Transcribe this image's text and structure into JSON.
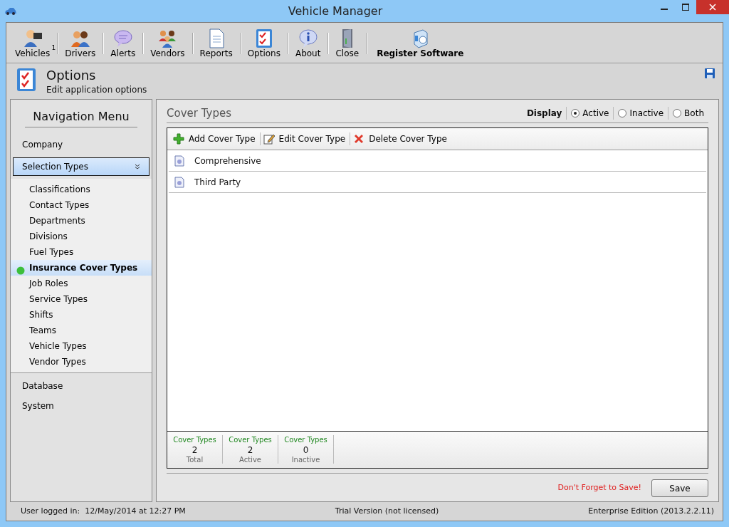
{
  "window": {
    "title": "Vehicle Manager"
  },
  "toolbar": [
    {
      "label": "Vehicles",
      "kind": "tool",
      "badge": "1"
    },
    {
      "label": "Drivers",
      "kind": "tool"
    },
    {
      "label": "Alerts",
      "kind": "tool"
    },
    {
      "label": "Vendors",
      "kind": "tool"
    },
    {
      "label": "Reports",
      "kind": "tool"
    },
    {
      "label": "Options",
      "kind": "tool"
    },
    {
      "label": "About",
      "kind": "tool"
    },
    {
      "label": "Close",
      "kind": "tool"
    },
    {
      "label": "Register Software",
      "kind": "highlight"
    }
  ],
  "header": {
    "title": "Options",
    "subtitle": "Edit application options"
  },
  "sidebar": {
    "title": "Navigation Menu",
    "items": [
      {
        "label": "Company",
        "expanded": false
      },
      {
        "label": "Selection Types",
        "expanded": true,
        "children": [
          {
            "label": "Classifications",
            "selected": false
          },
          {
            "label": "Contact Types",
            "selected": false
          },
          {
            "label": "Departments",
            "selected": false
          },
          {
            "label": "Divisions",
            "selected": false
          },
          {
            "label": "Fuel Types",
            "selected": false
          },
          {
            "label": "Insurance Cover Types",
            "selected": true
          },
          {
            "label": "Job Roles",
            "selected": false
          },
          {
            "label": "Service Types",
            "selected": false
          },
          {
            "label": "Shifts",
            "selected": false
          },
          {
            "label": "Teams",
            "selected": false
          },
          {
            "label": "Vehicle Types",
            "selected": false
          },
          {
            "label": "Vendor Types",
            "selected": false
          }
        ]
      },
      {
        "label": "Database",
        "expanded": false
      },
      {
        "label": "System",
        "expanded": false
      }
    ]
  },
  "content": {
    "title": "Cover Types",
    "display_label": "Display",
    "display_options": [
      {
        "label": "Active",
        "selected": true
      },
      {
        "label": "Inactive",
        "selected": false
      },
      {
        "label": "Both",
        "selected": false
      }
    ],
    "actions": [
      {
        "label": "Add Cover Type",
        "kind": "add"
      },
      {
        "label": "Edit Cover Type",
        "kind": "edit"
      },
      {
        "label": "Delete Cover Type",
        "kind": "delete"
      }
    ],
    "rows": [
      {
        "label": "Comprehensive"
      },
      {
        "label": "Third Party"
      }
    ],
    "stats": [
      {
        "label": "Cover Types",
        "value": "2",
        "caption": "Total"
      },
      {
        "label": "Cover Types",
        "value": "2",
        "caption": "Active"
      },
      {
        "label": "Cover Types",
        "value": "0",
        "caption": "Inactive"
      }
    ],
    "reminder": "Don't Forget to Save!",
    "save_button": "Save"
  },
  "status_bar": {
    "left": "User logged in:  12/May/2014 at 12:27 PM",
    "center": "Trial Version (not licensed)",
    "right": "Enterprise Edition (2013.2.2.11)"
  }
}
